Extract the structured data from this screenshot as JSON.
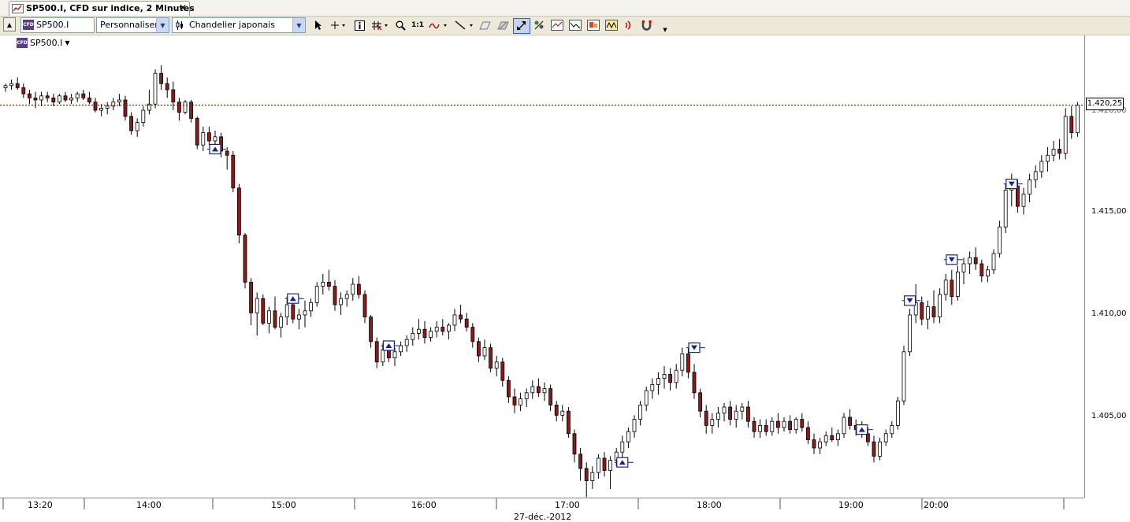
{
  "tab": {
    "title": "SP500.I, CFD sur indice, 2 Minutes",
    "close": "✕"
  },
  "toolbar": {
    "instrument": "SP500.I",
    "template": "Personnaliser",
    "chart_type": "Chandelier japonais",
    "zoom_label": "1:1",
    "icons": [
      "scroll-up-icon",
      "pointer-icon",
      "crosshair-icon",
      "info-icon",
      "grid-icon",
      "zoom-icon",
      "ratio-icon",
      "indicator-icon",
      "line-icon",
      "eraser-icon",
      "hide-icon",
      "autoscale-icon",
      "studies-icon",
      "template-icon",
      "compare-icon",
      "news-icon",
      "signal-icon",
      "magnet-icon",
      "more-icon"
    ]
  },
  "legend": {
    "instrument": "SP500.I"
  },
  "price_axis": {
    "labels": [
      "1.415,00",
      "1.410,00",
      "1.405,00"
    ],
    "current_price": "1.420,25",
    "partial_label": "1.420,00"
  },
  "time_axis": {
    "labels": [
      "13:20",
      "14:00",
      "15:00",
      "16:00",
      "17:00",
      "18:00",
      "19:00",
      "20:00"
    ],
    "date": "27-déc.-2012"
  },
  "colors": {
    "up": "#ffffff",
    "down": "#8b1a1a",
    "wick": "#000000",
    "price_line": "#cc0000",
    "marker": "#1a237e"
  },
  "chart_data": {
    "type": "candlestick",
    "title": "SP500.I, CFD sur indice, 2 Minutes",
    "xlabel": "27-déc.-2012",
    "ylabel": "",
    "ylim": [
      1400.0,
      1422.0
    ],
    "last_price": 1420.25,
    "candles": [
      [
        1421.1,
        1421.3,
        1420.9,
        1421.2
      ],
      [
        1421.2,
        1421.5,
        1421.0,
        1421.3
      ],
      [
        1421.3,
        1421.6,
        1421.0,
        1421.1
      ],
      [
        1421.1,
        1421.3,
        1420.6,
        1420.8
      ],
      [
        1420.8,
        1421.0,
        1420.3,
        1420.6
      ],
      [
        1420.6,
        1420.9,
        1420.1,
        1420.5
      ],
      [
        1420.5,
        1420.9,
        1420.2,
        1420.7
      ],
      [
        1420.7,
        1420.9,
        1420.4,
        1420.6
      ],
      [
        1420.6,
        1420.8,
        1420.2,
        1420.4
      ],
      [
        1420.4,
        1420.8,
        1420.3,
        1420.7
      ],
      [
        1420.7,
        1420.9,
        1420.4,
        1420.5
      ],
      [
        1420.5,
        1420.8,
        1420.3,
        1420.6
      ],
      [
        1420.6,
        1420.9,
        1420.4,
        1420.8
      ],
      [
        1420.8,
        1421.0,
        1420.5,
        1420.6
      ],
      [
        1420.6,
        1420.9,
        1420.3,
        1420.4
      ],
      [
        1420.4,
        1420.6,
        1419.9,
        1420.0
      ],
      [
        1420.0,
        1420.3,
        1419.7,
        1420.1
      ],
      [
        1420.1,
        1420.4,
        1419.8,
        1420.2
      ],
      [
        1420.2,
        1420.6,
        1420.0,
        1420.4
      ],
      [
        1420.4,
        1420.8,
        1420.2,
        1420.5
      ],
      [
        1420.5,
        1420.7,
        1419.5,
        1419.7
      ],
      [
        1419.7,
        1419.9,
        1418.8,
        1419.0
      ],
      [
        1419.0,
        1419.6,
        1418.7,
        1419.4
      ],
      [
        1419.4,
        1420.2,
        1419.2,
        1420.0
      ],
      [
        1420.0,
        1421.0,
        1419.8,
        1420.3
      ],
      [
        1420.3,
        1422.0,
        1420.1,
        1421.8
      ],
      [
        1421.8,
        1422.2,
        1421.0,
        1421.3
      ],
      [
        1421.3,
        1421.6,
        1420.6,
        1421.0
      ],
      [
        1421.0,
        1421.4,
        1420.0,
        1420.4
      ],
      [
        1420.4,
        1420.6,
        1419.5,
        1419.9
      ],
      [
        1419.9,
        1420.5,
        1419.8,
        1420.4
      ],
      [
        1420.4,
        1420.5,
        1419.4,
        1419.6
      ],
      [
        1419.6,
        1419.7,
        1418.1,
        1418.3
      ],
      [
        1418.3,
        1419.2,
        1418.0,
        1418.9
      ],
      [
        1418.9,
        1419.2,
        1418.3,
        1418.5
      ],
      [
        1418.5,
        1419.0,
        1418.1,
        1418.7
      ],
      [
        1418.7,
        1418.9,
        1417.7,
        1418.0
      ],
      [
        1418.0,
        1418.2,
        1417.1,
        1417.8
      ],
      [
        1417.8,
        1418.0,
        1416.0,
        1416.2
      ],
      [
        1416.2,
        1416.4,
        1413.5,
        1413.9
      ],
      [
        1413.9,
        1414.0,
        1411.3,
        1411.6
      ],
      [
        1411.6,
        1411.8,
        1409.5,
        1410.1
      ],
      [
        1410.1,
        1411.1,
        1409.0,
        1410.8
      ],
      [
        1410.8,
        1411.0,
        1409.5,
        1409.6
      ],
      [
        1409.6,
        1410.4,
        1409.1,
        1410.2
      ],
      [
        1410.2,
        1410.9,
        1409.3,
        1409.4
      ],
      [
        1409.4,
        1410.1,
        1408.9,
        1409.9
      ],
      [
        1409.9,
        1410.9,
        1409.5,
        1410.5
      ],
      [
        1410.5,
        1410.8,
        1409.6,
        1409.8
      ],
      [
        1409.8,
        1410.3,
        1409.3,
        1410.0
      ],
      [
        1410.0,
        1410.7,
        1409.4,
        1410.2
      ],
      [
        1410.2,
        1410.8,
        1409.9,
        1410.6
      ],
      [
        1410.6,
        1411.6,
        1410.4,
        1411.4
      ],
      [
        1411.4,
        1412.0,
        1411.0,
        1411.6
      ],
      [
        1411.6,
        1412.2,
        1411.2,
        1411.4
      ],
      [
        1411.4,
        1411.7,
        1410.2,
        1410.5
      ],
      [
        1410.5,
        1411.1,
        1410.0,
        1410.8
      ],
      [
        1410.8,
        1411.2,
        1410.4,
        1411.0
      ],
      [
        1411.0,
        1411.8,
        1410.7,
        1411.5
      ],
      [
        1411.5,
        1411.9,
        1410.8,
        1411.0
      ],
      [
        1411.0,
        1411.2,
        1409.6,
        1409.9
      ],
      [
        1409.9,
        1410.0,
        1408.4,
        1408.7
      ],
      [
        1408.7,
        1408.9,
        1407.4,
        1407.7
      ],
      [
        1407.7,
        1408.6,
        1407.5,
        1408.3
      ],
      [
        1408.3,
        1408.6,
        1407.7,
        1407.9
      ],
      [
        1407.9,
        1408.4,
        1407.5,
        1408.2
      ],
      [
        1408.2,
        1408.7,
        1408.0,
        1408.5
      ],
      [
        1408.5,
        1409.0,
        1408.2,
        1408.8
      ],
      [
        1408.8,
        1409.4,
        1408.5,
        1409.1
      ],
      [
        1409.1,
        1409.8,
        1408.8,
        1409.3
      ],
      [
        1409.3,
        1409.7,
        1408.6,
        1408.9
      ],
      [
        1408.9,
        1409.4,
        1408.7,
        1409.2
      ],
      [
        1409.2,
        1409.7,
        1408.9,
        1409.4
      ],
      [
        1409.4,
        1409.8,
        1409.0,
        1409.2
      ],
      [
        1409.2,
        1409.6,
        1408.8,
        1409.5
      ],
      [
        1409.5,
        1410.3,
        1409.2,
        1410.0
      ],
      [
        1410.0,
        1410.5,
        1409.6,
        1409.8
      ],
      [
        1409.8,
        1410.1,
        1409.2,
        1409.4
      ],
      [
        1409.4,
        1409.6,
        1408.4,
        1408.7
      ],
      [
        1408.7,
        1408.9,
        1407.7,
        1408.0
      ],
      [
        1408.0,
        1408.8,
        1407.8,
        1408.4
      ],
      [
        1408.4,
        1408.6,
        1407.2,
        1407.4
      ],
      [
        1407.4,
        1408.0,
        1407.0,
        1407.7
      ],
      [
        1407.7,
        1407.9,
        1406.5,
        1406.8
      ],
      [
        1406.8,
        1407.0,
        1405.7,
        1406.0
      ],
      [
        1406.0,
        1406.4,
        1405.2,
        1405.6
      ],
      [
        1405.6,
        1406.2,
        1405.3,
        1405.9
      ],
      [
        1405.9,
        1406.4,
        1405.5,
        1406.2
      ],
      [
        1406.2,
        1406.8,
        1405.9,
        1406.5
      ],
      [
        1406.5,
        1406.9,
        1406.0,
        1406.2
      ],
      [
        1406.2,
        1406.7,
        1405.8,
        1406.4
      ],
      [
        1406.4,
        1406.6,
        1405.3,
        1405.6
      ],
      [
        1405.6,
        1405.8,
        1404.8,
        1405.1
      ],
      [
        1405.1,
        1405.6,
        1404.8,
        1405.3
      ],
      [
        1405.3,
        1405.5,
        1404.0,
        1404.2
      ],
      [
        1404.2,
        1404.4,
        1402.8,
        1403.2
      ],
      [
        1403.2,
        1403.5,
        1401.9,
        1402.5
      ],
      [
        1402.5,
        1402.8,
        1401.1,
        1401.9
      ],
      [
        1401.9,
        1402.6,
        1401.5,
        1402.3
      ],
      [
        1402.3,
        1403.2,
        1402.0,
        1403.0
      ],
      [
        1403.0,
        1403.3,
        1402.1,
        1402.4
      ],
      [
        1402.4,
        1403.1,
        1401.5,
        1402.9
      ],
      [
        1402.9,
        1403.5,
        1402.6,
        1403.3
      ],
      [
        1403.3,
        1404.1,
        1403.0,
        1403.8
      ],
      [
        1403.8,
        1404.5,
        1403.5,
        1404.3
      ],
      [
        1404.3,
        1405.1,
        1404.0,
        1404.9
      ],
      [
        1404.9,
        1405.8,
        1404.6,
        1405.6
      ],
      [
        1405.6,
        1406.5,
        1405.3,
        1406.3
      ],
      [
        1406.3,
        1406.9,
        1405.9,
        1406.6
      ],
      [
        1406.6,
        1407.2,
        1406.1,
        1406.9
      ],
      [
        1406.9,
        1407.5,
        1406.4,
        1407.1
      ],
      [
        1407.1,
        1407.4,
        1406.3,
        1406.7
      ],
      [
        1406.7,
        1407.6,
        1406.4,
        1407.3
      ],
      [
        1407.3,
        1408.4,
        1407.0,
        1408.1
      ],
      [
        1408.1,
        1408.4,
        1406.9,
        1407.2
      ],
      [
        1407.2,
        1407.6,
        1405.9,
        1406.2
      ],
      [
        1406.2,
        1406.4,
        1405.0,
        1405.3
      ],
      [
        1405.3,
        1405.6,
        1404.2,
        1404.6
      ],
      [
        1404.6,
        1405.2,
        1404.2,
        1404.9
      ],
      [
        1404.9,
        1405.5,
        1404.5,
        1405.2
      ],
      [
        1405.2,
        1405.7,
        1404.8,
        1405.5
      ],
      [
        1405.5,
        1405.8,
        1404.6,
        1404.9
      ],
      [
        1404.9,
        1405.6,
        1404.5,
        1405.3
      ],
      [
        1405.3,
        1405.7,
        1404.9,
        1405.5
      ],
      [
        1405.5,
        1405.8,
        1404.5,
        1404.8
      ],
      [
        1404.8,
        1405.0,
        1404.0,
        1404.3
      ],
      [
        1404.3,
        1404.9,
        1404.0,
        1404.6
      ],
      [
        1404.6,
        1404.9,
        1404.1,
        1404.3
      ],
      [
        1404.3,
        1405.0,
        1404.1,
        1404.8
      ],
      [
        1404.8,
        1405.2,
        1404.2,
        1404.5
      ],
      [
        1404.5,
        1405.0,
        1404.3,
        1404.8
      ],
      [
        1404.8,
        1405.1,
        1404.2,
        1404.4
      ],
      [
        1404.4,
        1405.0,
        1404.2,
        1404.9
      ],
      [
        1404.9,
        1405.2,
        1404.3,
        1404.5
      ],
      [
        1404.5,
        1404.8,
        1403.7,
        1403.9
      ],
      [
        1403.9,
        1404.2,
        1403.2,
        1403.5
      ],
      [
        1403.5,
        1404.0,
        1403.2,
        1403.8
      ],
      [
        1403.8,
        1404.3,
        1403.6,
        1404.1
      ],
      [
        1404.1,
        1404.5,
        1403.8,
        1403.9
      ],
      [
        1403.9,
        1404.4,
        1403.6,
        1404.2
      ],
      [
        1404.2,
        1405.2,
        1404.0,
        1405.0
      ],
      [
        1405.0,
        1405.4,
        1404.4,
        1404.6
      ],
      [
        1404.6,
        1404.9,
        1404.1,
        1404.4
      ],
      [
        1404.4,
        1404.8,
        1404.0,
        1404.2
      ],
      [
        1404.2,
        1404.5,
        1403.6,
        1403.8
      ],
      [
        1403.8,
        1404.1,
        1402.8,
        1403.1
      ],
      [
        1403.1,
        1404.0,
        1402.9,
        1403.8
      ],
      [
        1403.8,
        1404.4,
        1403.6,
        1404.2
      ],
      [
        1404.2,
        1404.8,
        1404.0,
        1404.6
      ],
      [
        1404.6,
        1406.0,
        1404.4,
        1405.8
      ],
      [
        1405.8,
        1408.5,
        1405.6,
        1408.2
      ],
      [
        1408.2,
        1410.3,
        1408.0,
        1410.0
      ],
      [
        1410.0,
        1411.5,
        1409.6,
        1410.6
      ],
      [
        1410.6,
        1410.9,
        1409.5,
        1409.8
      ],
      [
        1409.8,
        1410.7,
        1409.3,
        1410.4
      ],
      [
        1410.4,
        1411.2,
        1409.6,
        1409.9
      ],
      [
        1409.9,
        1411.3,
        1409.6,
        1411.0
      ],
      [
        1411.0,
        1412.0,
        1410.7,
        1411.7
      ],
      [
        1411.7,
        1412.2,
        1410.5,
        1410.9
      ],
      [
        1410.9,
        1412.4,
        1410.7,
        1412.1
      ],
      [
        1412.1,
        1412.8,
        1411.5,
        1412.5
      ],
      [
        1412.5,
        1413.1,
        1412.0,
        1412.8
      ],
      [
        1412.8,
        1413.3,
        1412.2,
        1412.5
      ],
      [
        1412.5,
        1412.7,
        1411.6,
        1411.9
      ],
      [
        1411.9,
        1412.4,
        1411.6,
        1412.2
      ],
      [
        1412.2,
        1413.2,
        1412.0,
        1413.0
      ],
      [
        1413.0,
        1414.6,
        1412.8,
        1414.3
      ],
      [
        1414.3,
        1416.4,
        1414.0,
        1416.1
      ],
      [
        1416.1,
        1416.9,
        1415.3,
        1416.3
      ],
      [
        1416.3,
        1416.6,
        1415.0,
        1415.3
      ],
      [
        1415.3,
        1416.2,
        1414.9,
        1415.9
      ],
      [
        1415.9,
        1416.9,
        1415.5,
        1416.6
      ],
      [
        1416.6,
        1417.3,
        1416.2,
        1417.0
      ],
      [
        1417.0,
        1417.8,
        1416.7,
        1417.5
      ],
      [
        1417.5,
        1418.2,
        1417.0,
        1417.8
      ],
      [
        1417.8,
        1418.5,
        1417.5,
        1418.1
      ],
      [
        1418.1,
        1418.6,
        1417.6,
        1417.9
      ],
      [
        1417.9,
        1420.1,
        1417.6,
        1419.7
      ],
      [
        1419.7,
        1420.2,
        1418.6,
        1418.9
      ],
      [
        1418.9,
        1420.4,
        1418.7,
        1420.25
      ]
    ],
    "markers": [
      {
        "dir": "up",
        "i": 35,
        "price": 1418.1
      },
      {
        "dir": "up",
        "i": 48,
        "price": 1410.8
      },
      {
        "dir": "up",
        "i": 64,
        "price": 1408.5
      },
      {
        "dir": "up",
        "i": 103,
        "price": 1402.8
      },
      {
        "dir": "down",
        "i": 115,
        "price": 1408.4
      },
      {
        "dir": "up",
        "i": 143,
        "price": 1404.4
      },
      {
        "dir": "down",
        "i": 151,
        "price": 1410.7
      },
      {
        "dir": "down",
        "i": 158,
        "price": 1412.7
      },
      {
        "dir": "down",
        "i": 168,
        "price": 1416.4
      }
    ]
  }
}
